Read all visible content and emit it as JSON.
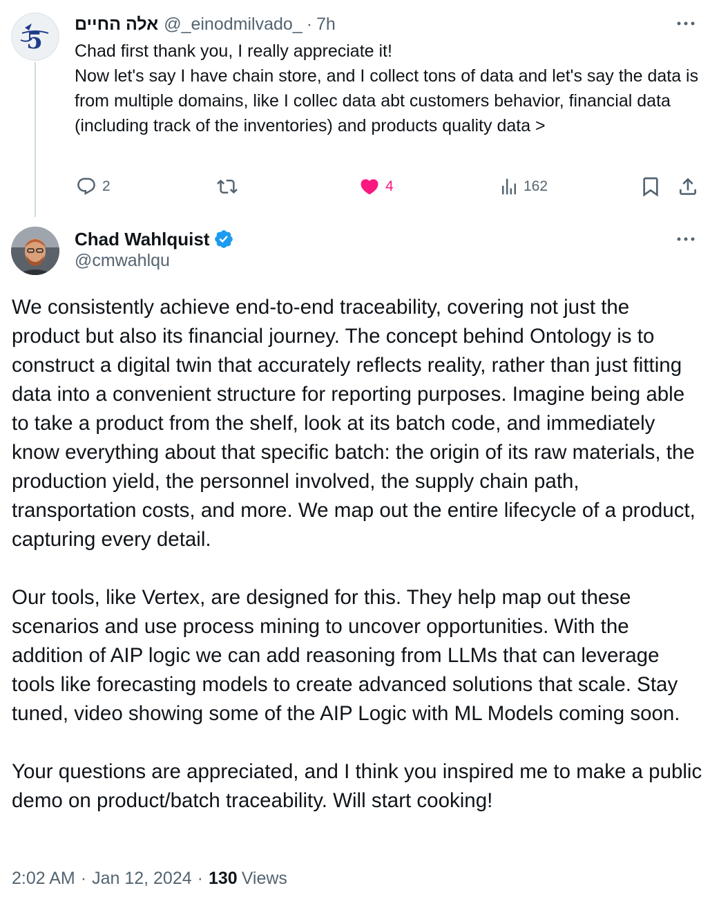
{
  "reply": {
    "author_name": "אלה החיים",
    "handle": "@_einodmilvado_",
    "separator": "·",
    "time": "7h",
    "text_lines": [
      "Chad first thank you, I really appreciate it!",
      "Now let's say I have chain store, and I collect tons of data and let's say the data is from multiple domains, like I collec data abt customers behavior, financial data (including track of the inventories) and products quality data >"
    ],
    "actions": {
      "replies": "2",
      "retweets": "",
      "likes": "4",
      "views": "162"
    }
  },
  "main": {
    "author_name": "Chad Wahlquist",
    "handle": "@cmwahlqu",
    "verified": true,
    "paragraphs": [
      "We consistently achieve end-to-end traceability, covering not just the product but also its financial journey. The concept behind Ontology is to construct a digital twin that accurately reflects reality, rather than just fitting data into a convenient structure for reporting purposes. Imagine being able to take a product from the shelf, look at its batch code, and immediately know everything about that specific batch: the origin of its raw materials, the production yield, the personnel involved, the supply chain path, transportation costs, and more. We map out the entire lifecycle of a product, capturing every detail.",
      "Our tools, like Vertex, are designed for this. They help map out these scenarios and use process mining to uncover opportunities. With the addition of AIP logic we can add reasoning from LLMs that can leverage tools like forecasting models to create advanced solutions that scale. Stay tuned, video showing some of the AIP Logic with ML Models coming soon.",
      "Your questions are appreciated, and I think you inspired me to make a public demo on product/batch traceability. Will start cooking!"
    ],
    "meta": {
      "time": "2:02 AM",
      "separator": "·",
      "date": "Jan 12, 2024",
      "views_count": "130",
      "views_label": "Views"
    }
  },
  "colors": {
    "text": "#0f1419",
    "secondary": "#536471",
    "like": "#f91880",
    "verified": "#1d9bf0",
    "thread_line": "#cfd9de"
  },
  "icons": [
    "more-icon",
    "reply-icon",
    "retweet-icon",
    "heart-icon",
    "views-icon",
    "bookmark-icon",
    "share-icon",
    "verified-badge-icon"
  ]
}
